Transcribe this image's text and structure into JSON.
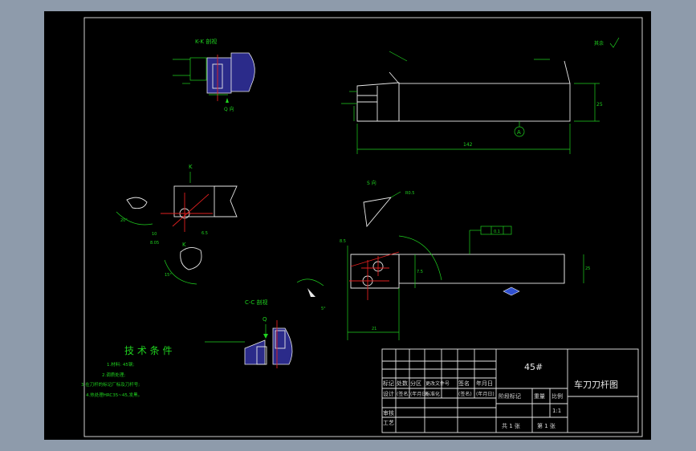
{
  "section_kk": "K-K 剖视",
  "section_cc": "C-C 剖视",
  "view_q": "Q 向",
  "view_s": "S 向",
  "label_k_top": "K",
  "label_k_mid": "K",
  "label_q": "Q",
  "datum_a": "A",
  "roughness_note": "其余",
  "dim_length": "142",
  "dim_height": "25",
  "dim_width": "21",
  "dim_a": "6.5",
  "dim_b": "25.5",
  "dim_c": "8.5",
  "dim_d": "10",
  "dim_e": "8.05",
  "dim_f": "R0.5",
  "dim_g": "20°",
  "dim_h": "15°",
  "dim_i": "5°",
  "dim_j": "7.5",
  "dim_k": "25",
  "tolerance": "0.1",
  "tech": {
    "title": "技 术 条 件",
    "lines": [
      "1.材料: 45钢;",
      "2.调质处理;",
      "3.在刀杆的标记厂标及刀杆号;",
      "4.热处理HRC35~45,发黑。"
    ]
  },
  "title_block": {
    "material": "45#",
    "name": "车刀刀杆图",
    "scale": "1:1",
    "h1": [
      "标记",
      "处数",
      "分区",
      "更改文件号",
      "签名",
      "年月日"
    ],
    "h2": [
      "设计",
      "(签名)",
      "(年月日)",
      "标准化",
      "(签名)",
      "(年月日)"
    ],
    "stage": "阶段标记",
    "weight": "重量",
    "ratio": "比例",
    "review": "审核",
    "process": "工艺",
    "sheets": "共 1 张",
    "sheet": "第 1 张"
  }
}
